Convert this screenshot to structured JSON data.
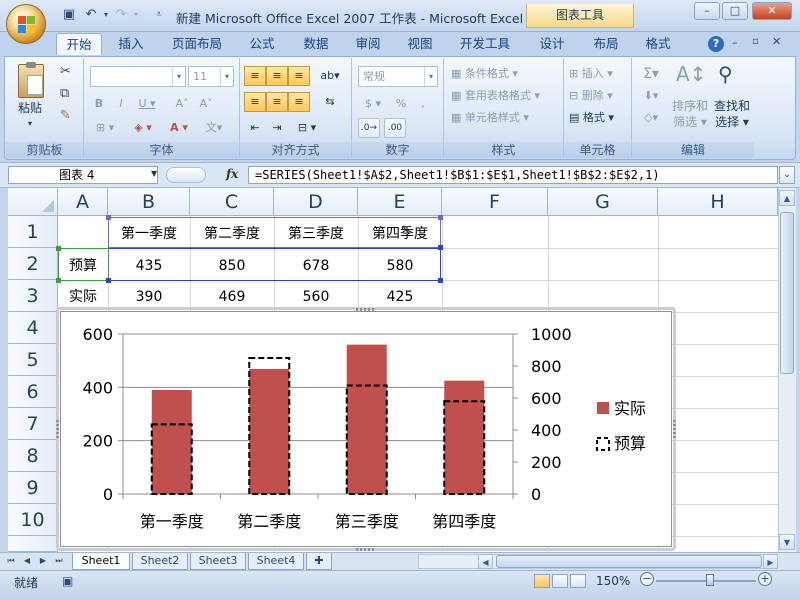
{
  "window": {
    "title": "新建 Microsoft Office Excel 2007 工作表 - Microsoft Excel",
    "context_title": "图表工具",
    "min": "–",
    "max": "□",
    "close": "✕"
  },
  "tabs": [
    "开始",
    "插入",
    "页面布局",
    "公式",
    "数据",
    "审阅",
    "视图",
    "开发工具",
    "设计",
    "布局",
    "格式"
  ],
  "ribbon": {
    "clipboard": {
      "label": "剪贴板",
      "paste": "粘贴"
    },
    "font": {
      "label": "字体",
      "font_name": "",
      "font_size": "11"
    },
    "alignment": {
      "label": "对齐方式"
    },
    "number": {
      "label": "数字",
      "format": "常规",
      "percent": "%"
    },
    "styles": {
      "label": "样式",
      "conditional": "条件格式",
      "table_format": "套用表格格式",
      "cell_styles": "单元格样式"
    },
    "cells": {
      "label": "单元格",
      "insert": "插入",
      "delete": "删除",
      "format": "格式"
    },
    "editing": {
      "label": "编辑",
      "sort": "排序和",
      "filter": "筛选",
      "find": "查找和",
      "select": "选择"
    }
  },
  "formula_bar": {
    "name_box": "图表 4",
    "fx": "fx",
    "formula": "=SERIES(Sheet1!$A$2,Sheet1!$B$1:$E$1,Sheet1!$B$2:$E$2,1)"
  },
  "columns": [
    "A",
    "B",
    "C",
    "D",
    "E",
    "F",
    "G",
    "H"
  ],
  "rows": [
    "1",
    "2",
    "3",
    "4",
    "5",
    "6",
    "7",
    "8",
    "9",
    "10"
  ],
  "cells": {
    "header": [
      "第一季度",
      "第二季度",
      "第三季度",
      "第四季度"
    ],
    "row2": {
      "label": "预算",
      "values": [
        "435",
        "850",
        "678",
        "580"
      ]
    },
    "row3": {
      "label": "实际",
      "values": [
        "390",
        "469",
        "560",
        "425"
      ]
    }
  },
  "chart_data": {
    "type": "bar",
    "categories": [
      "第一季度",
      "第二季度",
      "第三季度",
      "第四季度"
    ],
    "series": [
      {
        "name": "实际",
        "values": [
          390,
          469,
          560,
          425
        ],
        "axis": "left",
        "color": "#c0504d"
      },
      {
        "name": "预算",
        "values": [
          435,
          850,
          678,
          580
        ],
        "axis": "right",
        "style": "dashed-outline"
      }
    ],
    "ylim": [
      0,
      600
    ],
    "yticks": [
      0,
      200,
      400,
      600
    ],
    "y2lim": [
      0,
      1000
    ],
    "y2ticks": [
      0,
      200,
      400,
      600,
      800,
      1000
    ],
    "grid": true,
    "legend": "right"
  },
  "sheets": [
    "Sheet1",
    "Sheet2",
    "Sheet3",
    "Sheet4"
  ],
  "status": {
    "text": "就绪",
    "zoom": "150%"
  }
}
